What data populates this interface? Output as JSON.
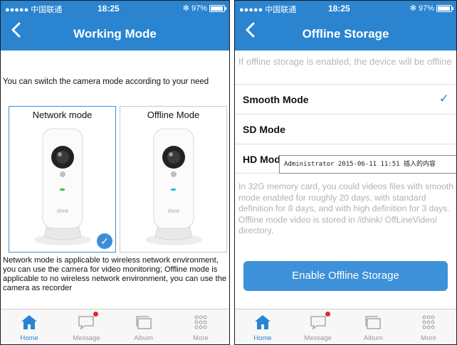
{
  "status_bar": {
    "carrier": "●●●●● 中国联通",
    "time": "18:25",
    "bluetooth": "✻",
    "battery": "97%"
  },
  "left": {
    "title": "Working Mode",
    "intro": "You can switch the camera mode according to your need",
    "cards": [
      {
        "label": "Network mode",
        "selected": true,
        "led_color": "#3cc43c"
      },
      {
        "label": "Offline Mode",
        "selected": false,
        "led_color": "#27b6e0"
      }
    ],
    "camera_brand": "ithink",
    "description": "Network mode is applicable to wireless network environment, you can use the camera for video monitoring; Offline mode is applicable to no wireless network environment, you can use the camera as recorder"
  },
  "right": {
    "title": "Offline Storage",
    "note": "If offline storage is enabled, the device will be offline",
    "options": [
      {
        "label": "Smooth Mode",
        "checked": true
      },
      {
        "label": "SD Mode",
        "checked": false
      },
      {
        "label": "HD Mode",
        "checked": false
      }
    ],
    "tooltip": "Administrator 2015-06-11 11:51 插入的内容",
    "info": "In 32G memory card, you could videos files with smooth mode enabled for roughly 20 days, with standard definition for 8 days, and with high definition for 3 days. Offline mode video is stored in /ithink/ OffLineVideo/ directory.",
    "enable_button": "Enable Offline Storage"
  },
  "tabs": [
    {
      "label": "Home",
      "icon": "home-icon",
      "active": true
    },
    {
      "label": "Message",
      "icon": "message-icon",
      "active": false,
      "notification": true
    },
    {
      "label": "Album",
      "icon": "album-icon",
      "active": false
    },
    {
      "label": "More",
      "icon": "more-icon",
      "active": false
    }
  ],
  "colors": {
    "primary": "#2a84d0",
    "button": "#3d91d8",
    "note_text": "#b2b2b2",
    "badge": "#e22a2a"
  }
}
